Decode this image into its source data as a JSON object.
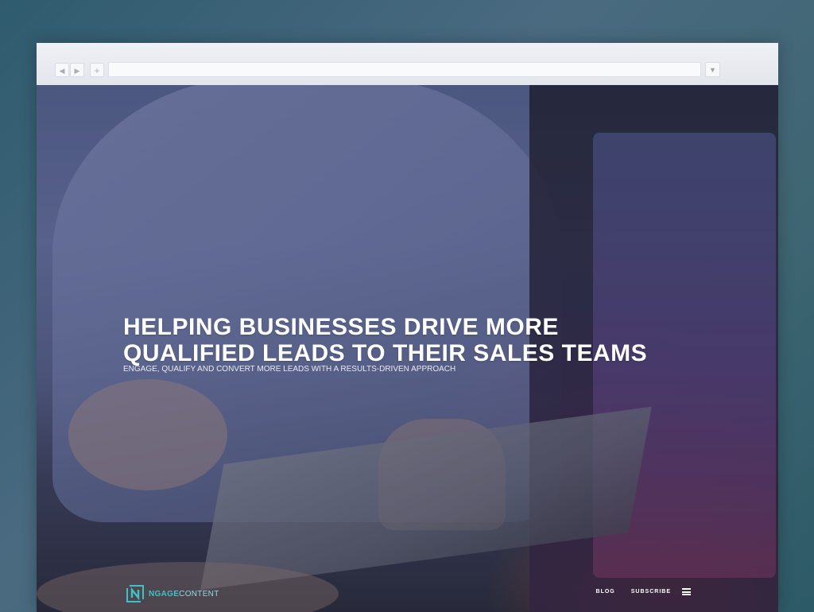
{
  "browser": {
    "nav_back_glyph": "◀",
    "nav_forward_glyph": "▶",
    "new_tab_glyph": "+",
    "menu_glyph": "▼",
    "address_value": ""
  },
  "hero": {
    "headline_line1": "HELPING BUSINESSES DRIVE MORE",
    "headline_line2": "QUALIFIED LEADS TO THEIR SALES TEAMS",
    "subheadline": "ENGAGE, QUALIFY AND CONVERT MORE LEADS WITH A RESULTS-DRIVEN APPROACH"
  },
  "footer": {
    "logo_bold": "NGAGE",
    "logo_light": "CONTENT",
    "nav": [
      {
        "label": "BLOG"
      },
      {
        "label": "SUBSCRIBE"
      }
    ],
    "menu_icon": "hamburger-icon"
  },
  "colors": {
    "accent": "#3fc2c6",
    "background_top": "#2f5b6e",
    "chrome": "#e3e6ec"
  }
}
